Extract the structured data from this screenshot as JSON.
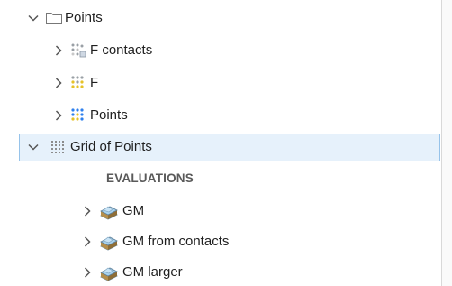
{
  "tree": {
    "root": {
      "label": "Points",
      "expanded": true,
      "icon": "folder-icon"
    },
    "items": [
      {
        "label": "F contacts",
        "icon": "points-contacts-icon"
      },
      {
        "label": "F",
        "icon": "points-yellow-icon"
      },
      {
        "label": "Points",
        "icon": "points-colored-icon"
      },
      {
        "label": "Grid of Points",
        "icon": "grid-points-icon",
        "expanded": true,
        "selected": true
      }
    ],
    "section_header": "EVALUATIONS",
    "evaluations": [
      {
        "label": "GM",
        "icon": "evaluation-icon"
      },
      {
        "label": "GM from contacts",
        "icon": "evaluation-icon"
      },
      {
        "label": "GM larger",
        "icon": "evaluation-icon"
      }
    ]
  },
  "colors": {
    "selection_bg": "#e6f1fb",
    "selection_border": "#96c3ea",
    "chevron": "#555555"
  }
}
